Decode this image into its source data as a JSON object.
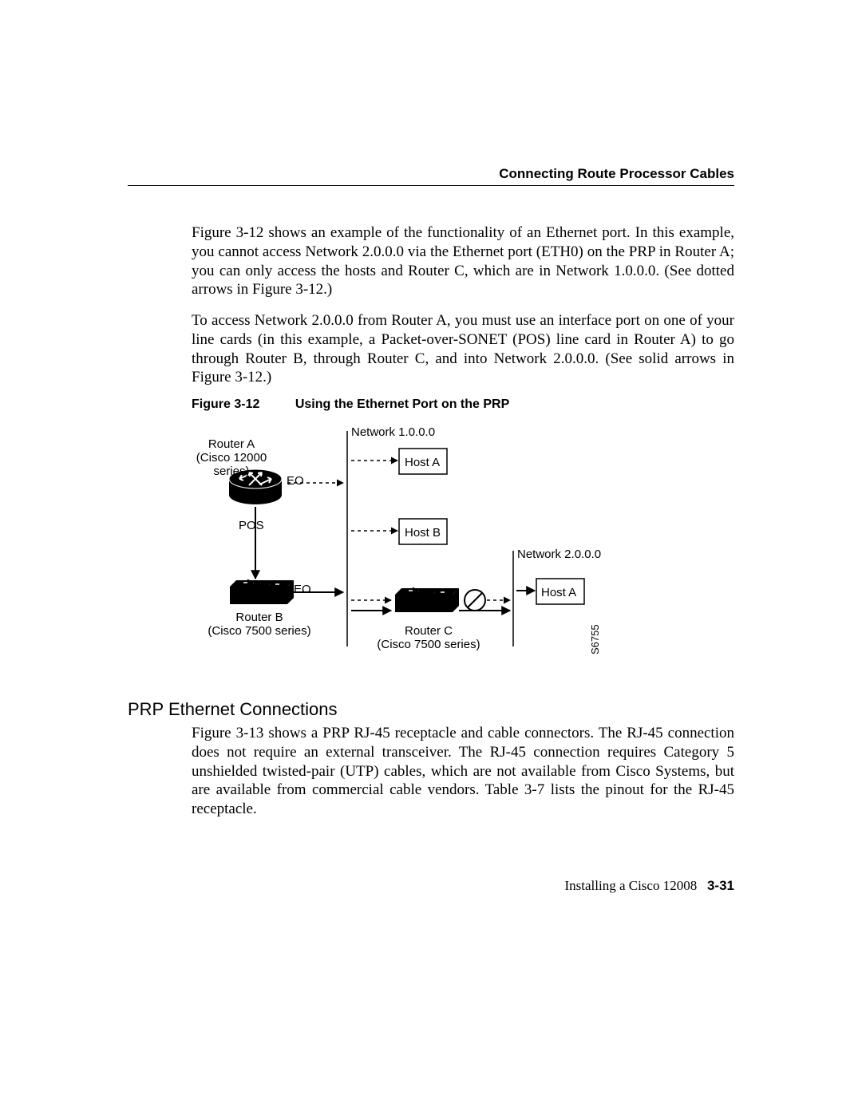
{
  "header": {
    "running_head": "Connecting Route Processor Cables"
  },
  "paragraphs": {
    "p1": "Figure 3-12 shows an example of the functionality of an Ethernet port. In this example, you cannot access Network 2.0.0.0 via the Ethernet port (ETH0) on the PRP in Router A; you can only access the hosts and Router C, which are in Network 1.0.0.0. (See dotted arrows in Figure 3-12.)",
    "p2": "To access Network 2.0.0.0 from Router A, you must use an interface port on one of your line cards (in this example, a Packet-over-SONET (POS) line card in Router A) to go through Router B, through Router C, and into Network 2.0.0.0. (See solid arrows in Figure 3-12.)",
    "p3": "Figure 3-13 shows a PRP RJ-45 receptacle and cable connectors. The RJ-45 connection does not require an external transceiver. The RJ-45 connection requires Category 5 unshielded twisted-pair (UTP) cables, which are not available from Cisco Systems, but are available from commercial cable vendors. Table 3-7 lists the pinout for the RJ-45 receptacle."
  },
  "figure": {
    "ref": "Figure 3-12",
    "title": "Using the Ethernet Port on the PRP",
    "labels": {
      "routerA_line1": "Router A",
      "routerA_line2": "(Cisco 12000 series)",
      "routerB_line1": "Router B",
      "routerB_line2": "(Cisco 7500 series)",
      "routerC_line1": "Router C",
      "routerC_line2": "(Cisco 7500 series)",
      "net1": "Network 1.0.0.0",
      "net2": "Network 2.0.0.0",
      "hostA": "Host A",
      "hostB": "Host B",
      "hostA2": "Host A",
      "eo1": "EO",
      "eo2": "EO",
      "pos": "POS",
      "id": "S6755"
    }
  },
  "section": {
    "title": "PRP Ethernet Connections"
  },
  "footer": {
    "doc": "Installing a Cisco 12008",
    "page": "3-31"
  }
}
